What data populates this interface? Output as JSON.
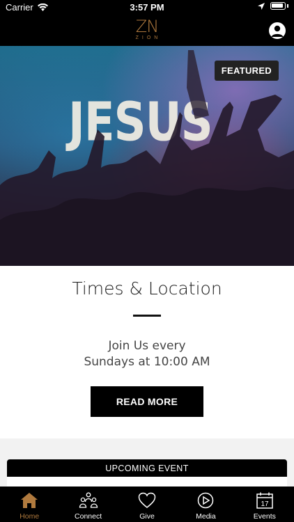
{
  "status_bar": {
    "carrier": "Carrier",
    "time": "3:57 PM"
  },
  "nav": {
    "logo_mark": "ZN",
    "logo_sub": "ZION"
  },
  "hero": {
    "overlay_word": "JESUS",
    "badge": "FEATURED"
  },
  "card": {
    "title": "Times & Location",
    "body_line1": "Join Us every",
    "body_line2": "Sundays at 10:00 AM",
    "button_label": "READ MORE"
  },
  "upcoming": {
    "header": "UPCOMING EVENT"
  },
  "tabs": [
    {
      "label": "Home",
      "icon": "home-icon",
      "active": true
    },
    {
      "label": "Connect",
      "icon": "people-icon",
      "active": false
    },
    {
      "label": "Give",
      "icon": "heart-icon",
      "active": false
    },
    {
      "label": "Media",
      "icon": "play-icon",
      "active": false
    },
    {
      "label": "Events",
      "icon": "calendar-icon",
      "active": false,
      "calendar_day": "17"
    }
  ],
  "colors": {
    "accent": "#b07a3e",
    "bar": "#000000",
    "badge": "#222222"
  }
}
